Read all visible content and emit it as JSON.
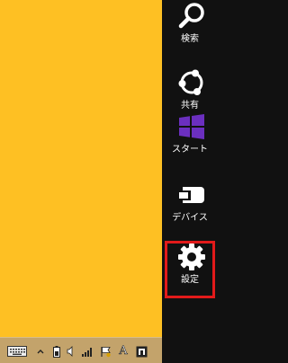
{
  "charms": {
    "search_label": "検索",
    "share_label": "共有",
    "start_label": "スタート",
    "devices_label": "デバイス",
    "settings_label": "設定"
  },
  "taskbar": {
    "ime_label": "A"
  },
  "colors": {
    "desktop_background": "#FEC023",
    "charms_background": "#111111",
    "start_accent": "#6B2FBF",
    "selection_outline": "#E21A1A",
    "taskbar_background": "#C3A36B"
  },
  "icons": [
    "search-icon",
    "share-icon",
    "windows-logo-icon",
    "devices-icon",
    "gear-icon",
    "keyboard-icon",
    "show-hidden-icons-icon",
    "battery-icon",
    "volume-icon",
    "network-signal-icon",
    "action-center-flag-icon",
    "ime-icon",
    "notification-icon"
  ]
}
